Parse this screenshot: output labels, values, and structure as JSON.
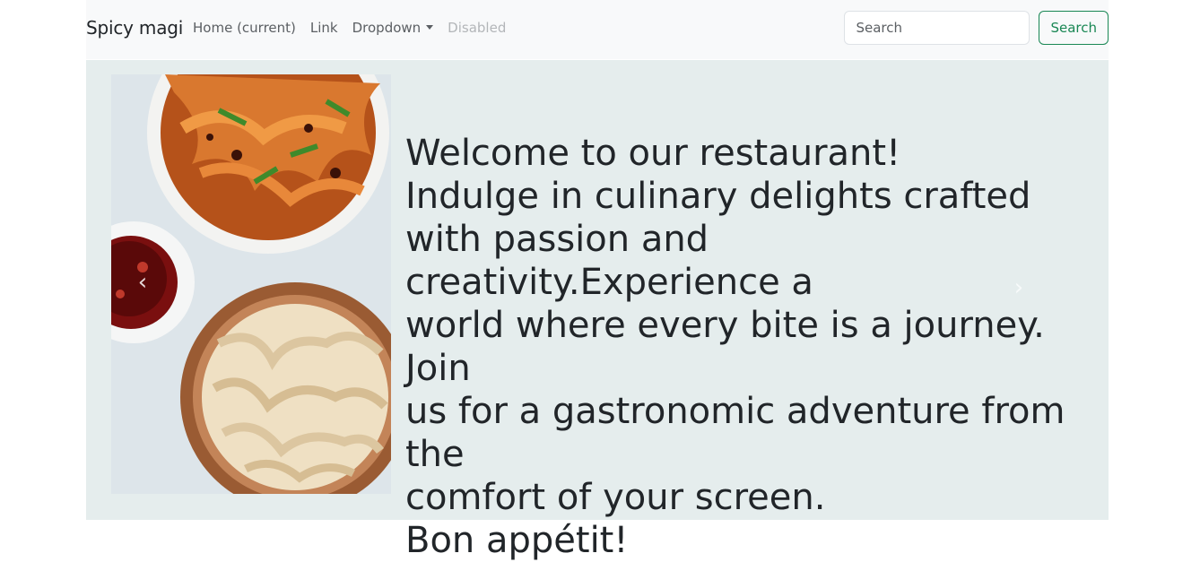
{
  "navbar": {
    "brand": "Spicy magi",
    "links": [
      {
        "label": "Home (current)"
      },
      {
        "label": "Link"
      },
      {
        "label": "Dropdown"
      },
      {
        "label": "Disabled"
      }
    ],
    "search": {
      "placeholder": "Search",
      "button_label": "Search"
    }
  },
  "hero": {
    "image_alt": "Bowls of noodles and chili sauce",
    "lines": [
      "Welcome to our restaurant!",
      "Indulge in culinary delights crafted",
      "with passion and creativity.Experience a",
      "world where every bite is a journey. Join",
      "us for a gastronomic adventure from the",
      "comfort of your screen.",
      "Bon appétit!"
    ],
    "prev_icon": "chevron-left-icon",
    "next_icon": "chevron-right-icon"
  },
  "colors": {
    "navbar_bg": "#f8f9fa",
    "hero_bg": "#e5eded",
    "success": "#198754",
    "text": "#212529"
  }
}
